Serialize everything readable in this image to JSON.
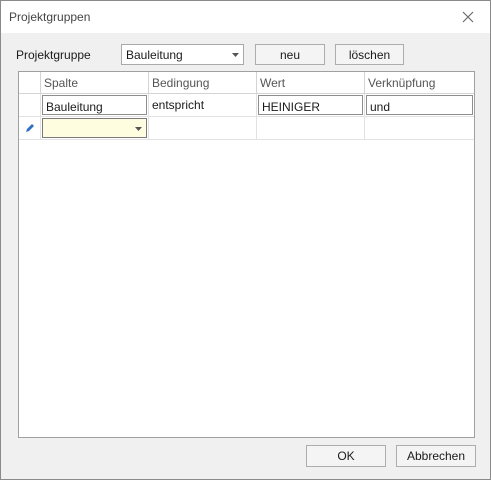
{
  "window": {
    "title": "Projektgruppen"
  },
  "toolbar": {
    "group_label": "Projektgruppe",
    "group_value": "Bauleitung",
    "new_label": "neu",
    "delete_label": "löschen"
  },
  "grid": {
    "columns": [
      "Spalte",
      "Bedingung",
      "Wert",
      "Verknüpfung"
    ],
    "rows": [
      {
        "spalte": "Bauleitung",
        "bedingung": "entspricht",
        "wert": "HEINIGER",
        "verknuepfung": "und"
      },
      {
        "spalte": "",
        "bedingung": "",
        "wert": "",
        "verknuepfung": ""
      }
    ]
  },
  "footer": {
    "ok_label": "OK",
    "cancel_label": "Abbrechen"
  }
}
